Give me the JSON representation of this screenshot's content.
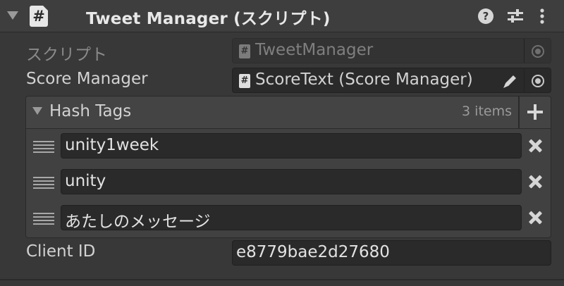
{
  "component": {
    "title": "Tweet Manager (スクリプト)",
    "script_icon": "#",
    "help_icon": "question-icon",
    "presets_icon": "presets-icon",
    "menu_icon": "kebab-menu-icon"
  },
  "script_field": {
    "label": "スクリプト",
    "value": "TweetManager",
    "icon": "#"
  },
  "score_manager": {
    "label": "Score Manager",
    "value": "ScoreText (Score Manager)",
    "icon": "#"
  },
  "hash_tags": {
    "label": "Hash Tags",
    "count": "3 items",
    "items": [
      {
        "value": "unity1week"
      },
      {
        "value": "unity"
      },
      {
        "value": "あたしのメッセージ"
      }
    ]
  },
  "client_id": {
    "label": "Client ID",
    "value": "e8779bae2d27680"
  },
  "colors": {
    "background": "#383838",
    "field": "#2a2a2a",
    "text": "#d2d2d2"
  }
}
